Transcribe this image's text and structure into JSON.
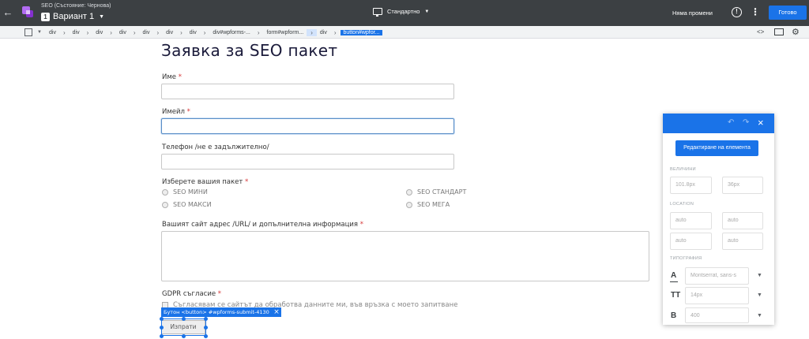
{
  "topbar": {
    "experiment_title": "SEO (Състояние: Чернова)",
    "variant_number": "1",
    "variant_name": "Вариант 1",
    "device_label": "Стандартно",
    "status_text": "Няма промени",
    "done_label": "Готово",
    "icons": [
      "back-arrow-icon",
      "optimize-logo-icon",
      "monitor-icon",
      "info-icon",
      "more-vert-icon"
    ]
  },
  "breadcrumb": {
    "items": [
      "div",
      "div",
      "div",
      "div",
      "div",
      "div",
      "div",
      "div#wpforms-...",
      "form#wpform...",
      "div",
      "button#wpfor..."
    ]
  },
  "form": {
    "title": "Заявка за SEO пакет",
    "name_label": "Име",
    "email_label": "Имейл",
    "phone_label": "Телефон /не е задължително/",
    "package_label": "Изберете вашия пакет",
    "package_options": [
      "SEO МИНИ",
      "SEO МАКСИ",
      "SEO СТАНДАРТ",
      "SEO МЕГА"
    ],
    "site_label": "Вашият сайт адрес /URL/ и допълнителна информация",
    "gdpr_label": "GDPR съгласие",
    "gdpr_text": "Съгласявам се сайтът да обработва данните ми, във връзка с моето запитване",
    "required_mark": "*",
    "submit_label": "Изпрати"
  },
  "selection": {
    "tag_label": "Бутон <button> #wpforms-submit-4130"
  },
  "panel": {
    "edit_button_label": "Редактиране на елемента",
    "size_title": "ВЕЛИЧИНИ",
    "width_value": "101.8px",
    "height_value": "36px",
    "location_title": "LOCATION",
    "location_values": [
      "auto",
      "auto",
      "auto",
      "auto"
    ],
    "typography_title": "ТИПОГРАФИЯ",
    "font_family": "Montserrat, sans-s",
    "font_size": "14px",
    "font_weight": "400",
    "accent_color": "#1a73e8"
  }
}
